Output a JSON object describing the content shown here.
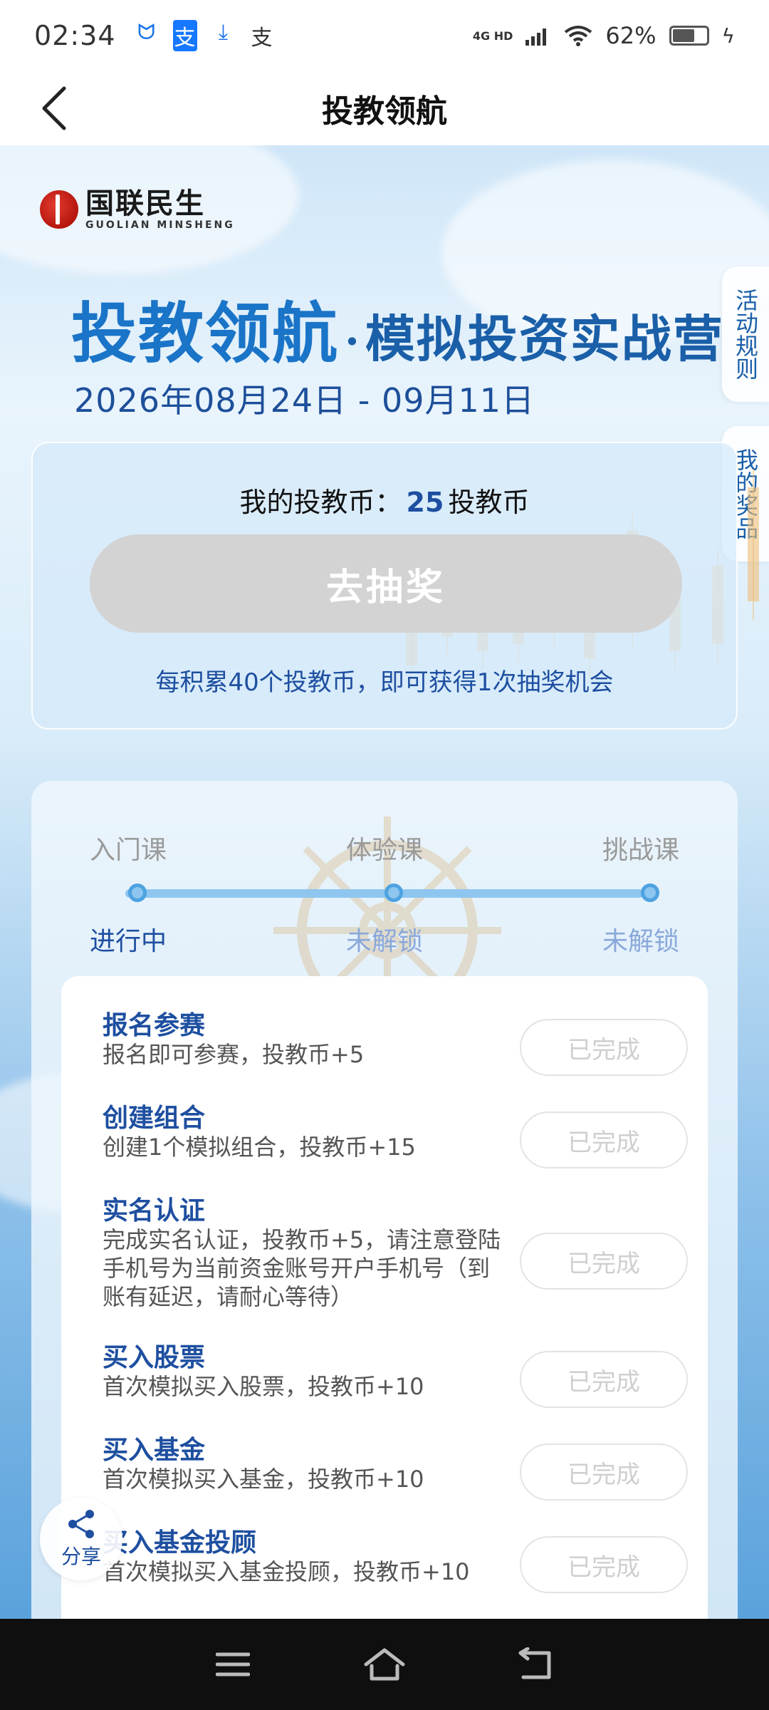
{
  "status_bar": {
    "time": "02:34",
    "network": "4G HD",
    "battery": "62%"
  },
  "header": {
    "title": "投教领航"
  },
  "brand": {
    "name_cn": "国联民生",
    "name_en": "GUOLIAN MINSHENG"
  },
  "hero": {
    "title_main": "投教领航",
    "separator": "·",
    "title_sub": "模拟投资实战营",
    "date_range": "2026年08月24日 - 09月11日"
  },
  "side_tabs": {
    "rules": "活动规则",
    "prizes": "我的奖品"
  },
  "coins": {
    "label": "我的投教币：",
    "value": "25",
    "unit": "投教币",
    "draw_button": "去抽奖",
    "hint": "每积累40个投教币，即可获得1次抽奖机会"
  },
  "course_steps": [
    {
      "label": "入门课",
      "status": "进行中",
      "active": true
    },
    {
      "label": "体验课",
      "status": "未解锁",
      "active": false
    },
    {
      "label": "挑战课",
      "status": "未解锁",
      "active": false
    }
  ],
  "tasks": [
    {
      "title": "报名参赛",
      "desc": "报名即可参赛，投教币+5",
      "button": "已完成"
    },
    {
      "title": "创建组合",
      "desc": "创建1个模拟组合，投教币+15",
      "button": "已完成"
    },
    {
      "title": "实名认证",
      "desc": "完成实名认证，投教币+5，请注意登陆手机号为当前资金账号开户手机号（到账有延迟，请耐心等待）",
      "button": "已完成"
    },
    {
      "title": "买入股票",
      "desc": "首次模拟买入股票，投教币+10",
      "button": "已完成"
    },
    {
      "title": "买入基金",
      "desc": "首次模拟买入基金，投教币+10",
      "button": "已完成"
    },
    {
      "title": "买入基金投顾",
      "desc": "首次模拟买入基金投顾，投教币+10",
      "button": "已完成"
    }
  ],
  "share": {
    "label": "分享"
  }
}
